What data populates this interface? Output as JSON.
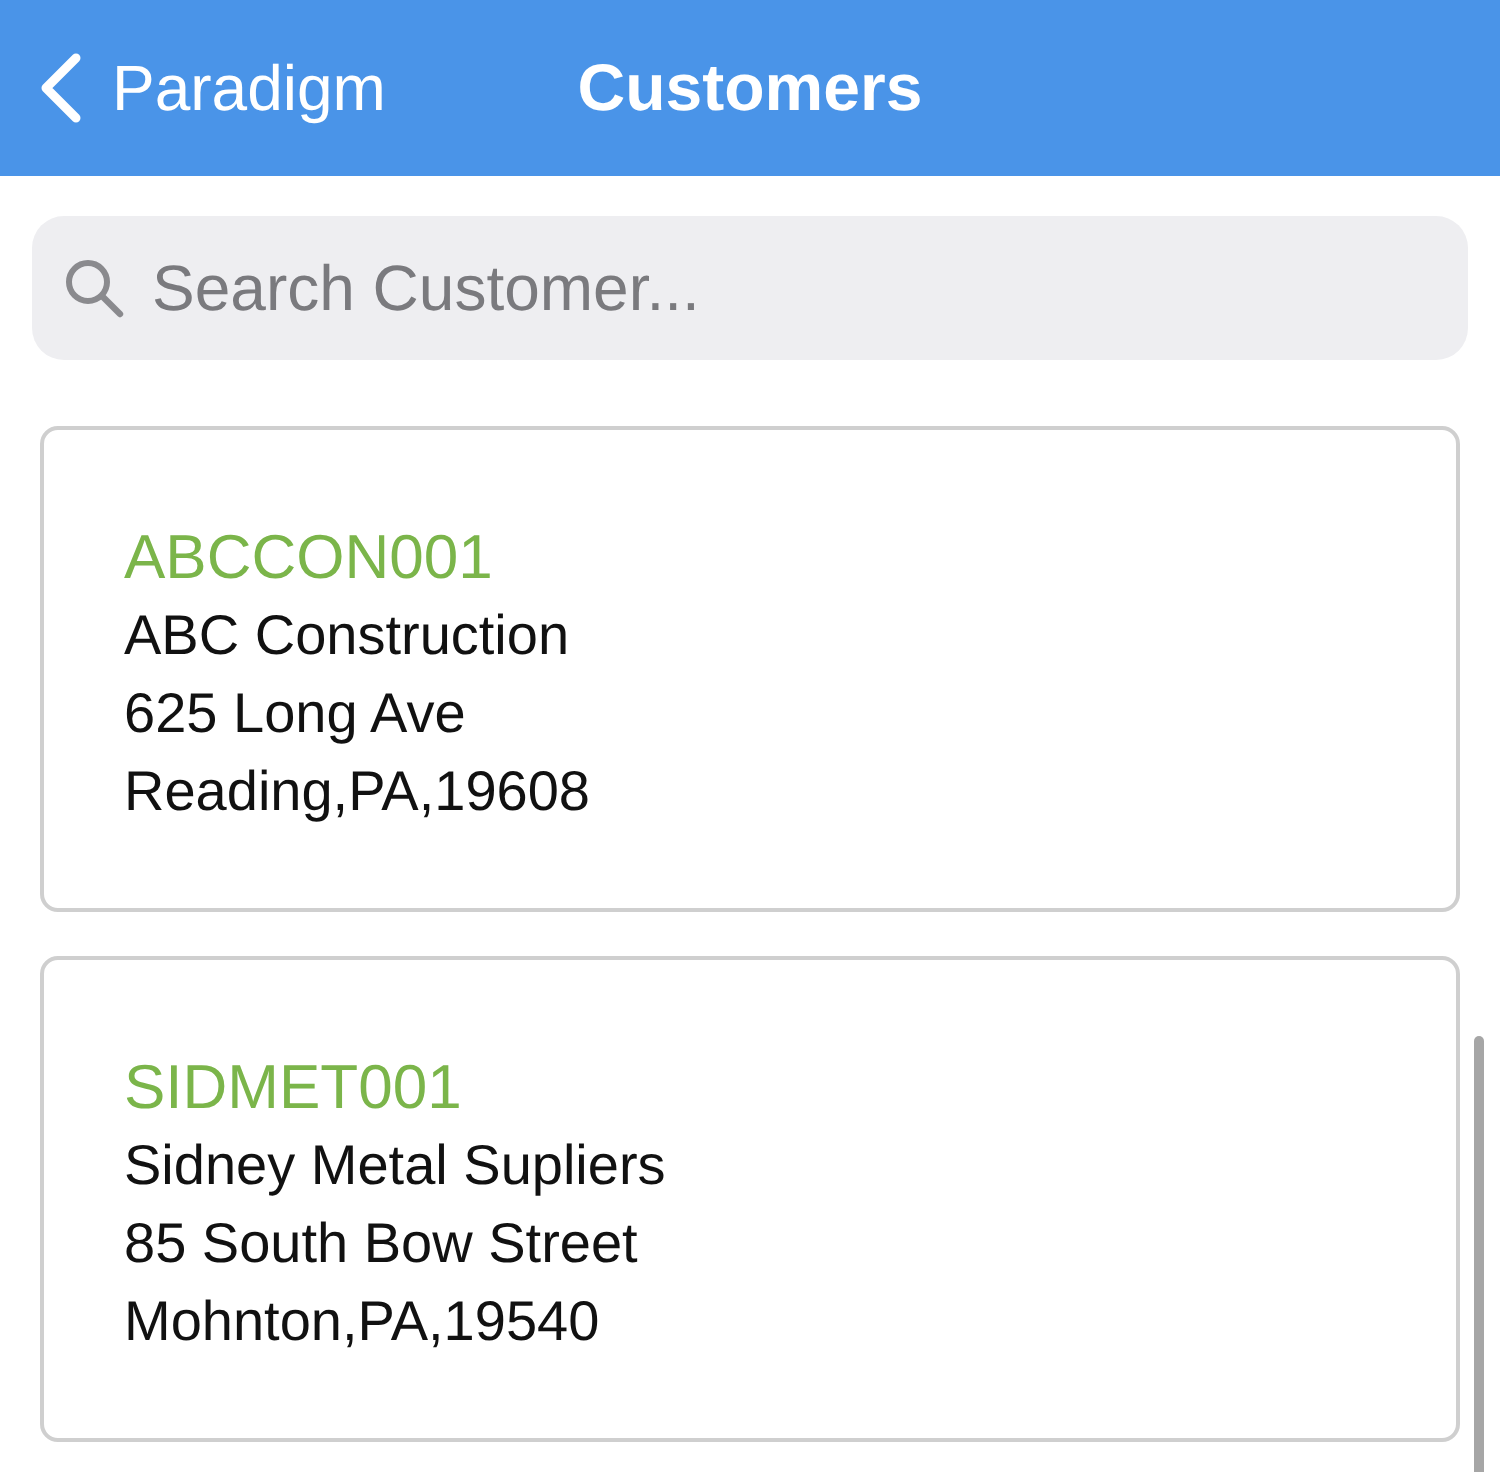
{
  "nav_bar": {
    "back_label": "Paradigm",
    "title": "Customers"
  },
  "search": {
    "placeholder": "Search Customer..."
  },
  "customers": [
    {
      "code": "ABCCON001",
      "name": "ABC Construction",
      "street": "625 Long Ave",
      "city_line": "Reading,PA,19608"
    },
    {
      "code": "SIDMET001",
      "name": "Sidney Metal Supliers",
      "street": "85 South Bow Street",
      "city_line": "Mohnton,PA,19540"
    }
  ]
}
